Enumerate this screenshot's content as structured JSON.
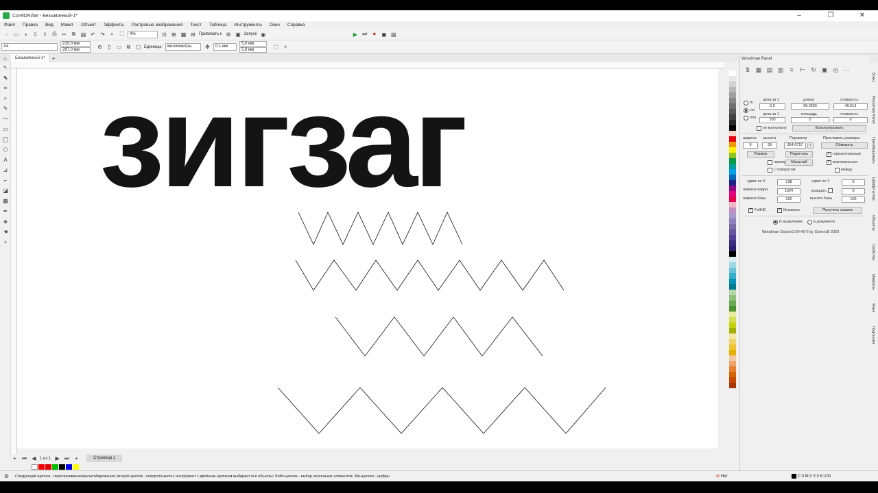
{
  "window": {
    "title": "CorelDRAW - Безымянный-1*"
  },
  "menu": [
    "Файл",
    "Правка",
    "Вид",
    "Макет",
    "Объект",
    "Эффекты",
    "Растровые изображения",
    "Текст",
    "Таблица",
    "Инструменты",
    "Окно",
    "Справка"
  ],
  "toolbar1": {
    "zoom": "4%",
    "snap": "Привязать к",
    "launch": "Запуск"
  },
  "toolbar2": {
    "page_size": "A4",
    "width": "210,0 мм",
    "height": "297,0 мм",
    "units_label": "Единицы:",
    "units_value": "миллиметры",
    "nudge": "0.1 мм",
    "dup_x": "5,0 мм",
    "dup_y": "5,0 мм"
  },
  "doc_tab": "Безымянный-1*",
  "canvas": {
    "big_text": "зигзаг"
  },
  "pagebar": {
    "page_counter": "1 из 1",
    "page_tab": "Страница 1"
  },
  "status": {
    "hint": "Следующий щелчок - перетаскивание/масштабирование; второй щелчок - поворот/наклон; инструмент с двойным щелчком выбирает все объекты; Shift+щелчок - выбор нескольких элементов; Alt+щелчок - цифры",
    "fill": "Нет",
    "outline": "C:0 M:0 Y:0 K:100"
  },
  "panel": {
    "title": "Woodman Panel",
    "units": [
      "m",
      "cm",
      "mm"
    ],
    "price1_label": "цена за 1",
    "price1_value": "0.5",
    "length_label": "длина",
    "length_value": "99.0265",
    "cost_label": "стоимость",
    "cost_value": "49.513",
    "price2_label": "цена за 1",
    "price2_value": "200",
    "area_label": "площадь",
    "area_value": "0",
    "cost2_label": "стоимость",
    "cost2_value": "0",
    "by_material": "по материалу",
    "calc_button": "Калькулировать",
    "width_label": "ширина",
    "width_value": "0",
    "height_label": "высота",
    "height_value": "38",
    "perimeter_label": "Периметр",
    "perimeter_value": "364.6757",
    "set_sizes_label": "Проставить размеры",
    "measure_button": "Обмерить",
    "size_button": "Размер",
    "fit_button": "Подогнать",
    "horizontal": "горизонтальные",
    "proportions": "пропорции",
    "scale_button": "Масштаб",
    "vertical": "вертикальные",
    "with_rotation": "с поворотом",
    "between": "между",
    "shift_x_label": "сдвиг по X",
    "shift_x_value": "138",
    "shift_y_label": "сдвиг по Y",
    "shift_y_value": "0",
    "frame_width_label": "ширина кадра",
    "frame_width_value": "1324",
    "rotate_label": "вращать",
    "rotate_value": "0",
    "base_width_label": "ширина базы",
    "base_width_value": "100",
    "base_height_label": "высота базы",
    "base_height_value": "100",
    "fullhd": "FullHD",
    "distort": "Искажать",
    "snapshot_button": "Получить снимок",
    "in_selection": "В выделении",
    "in_document": "в документе",
    "footer": "Woodman Docker3.00.49 © by DukeroD 2023"
  },
  "side_tabs": [
    "Эскиз",
    "Woodman Panel",
    "Преобразовать",
    "Шрифт-атлас",
    "Объекты",
    "Свойства",
    "Макросы",
    "Язык",
    "Подсказки"
  ]
}
